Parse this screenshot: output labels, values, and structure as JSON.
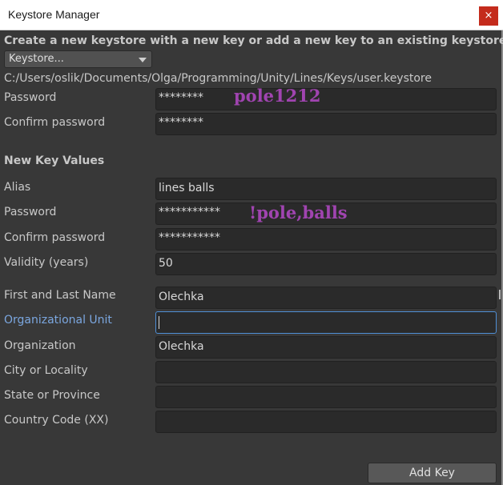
{
  "window": {
    "title": "Keystore Manager",
    "close_glyph": "×"
  },
  "header": {
    "description": "Create a new keystore with a new key or add a new key to an existing keystore",
    "keystore_dropdown": "Keystore...",
    "path": "C:/Users/oslik/Documents/Olga/Programming/Unity/Lines/Keys/user.keystore"
  },
  "keystore": {
    "password_label": "Password",
    "password_value": "********",
    "confirm_label": "Confirm password",
    "confirm_value": "********"
  },
  "new_key": {
    "heading": "New Key Values",
    "alias_label": "Alias",
    "alias_value": "lines balls",
    "password_label": "Password",
    "password_value": "***********",
    "confirm_label": "Confirm password",
    "confirm_value": "***********",
    "validity_label": "Validity (years)",
    "validity_value": "50",
    "name_label": "First and Last Name",
    "name_value": "Olechka",
    "org_unit_label": "Organizational Unit",
    "org_unit_value": "",
    "org_label": "Organization",
    "org_value": "Olechka",
    "city_label": "City or Locality",
    "city_value": "",
    "state_label": "State or Province",
    "state_value": "",
    "country_label": "Country Code (XX)",
    "country_value": ""
  },
  "annotations": {
    "keystore_password_note": "pole1212",
    "key_password_note": "!pole,balls"
  },
  "actions": {
    "add_key_label": "Add Key"
  },
  "colors": {
    "background": "#383838",
    "field_background": "#2a2a2a",
    "focus_accent": "#4f8fd6",
    "annotation": "#a044b0",
    "close_button": "#c42b1c"
  }
}
